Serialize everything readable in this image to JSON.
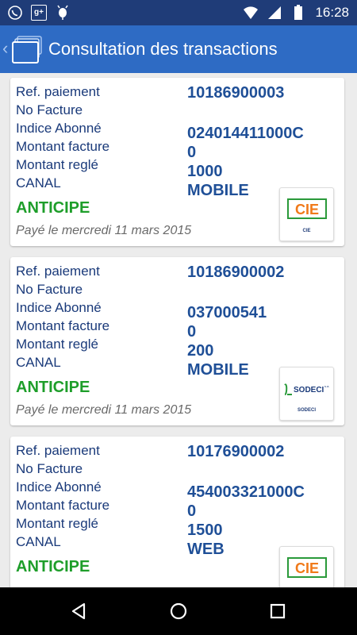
{
  "status_bar": {
    "time": "16:28",
    "left_icons": [
      "whatsapp-icon",
      "google-plus-icon",
      "android-debug-icon"
    ],
    "google_plus_label": "g+",
    "right_icons": [
      "wifi-icon",
      "cellular-signal-icon",
      "battery-icon"
    ]
  },
  "action_bar": {
    "title": "Consultation des transactions",
    "back_glyph": "‹"
  },
  "labels": {
    "ref": "Ref. paiement",
    "facture": "No Facture",
    "indice": "Indice Abonné",
    "montant_facture": "Montant facture",
    "montant_regle": "Montant reglé",
    "canal": "CANAL"
  },
  "transactions": [
    {
      "ref_paiement": "10186900003",
      "no_facture": "",
      "indice_abonne": "024014411000C",
      "montant_facture": "0",
      "montant_regle": "1000",
      "canal": "MOBILE",
      "status": "ANTICIPE",
      "pay_date": "Payé le mercredi 11 mars 2015",
      "provider": "CIE",
      "provider_logo_text": "CIE",
      "provider_caption": "CIE"
    },
    {
      "ref_paiement": "10186900002",
      "no_facture": "",
      "indice_abonne": "037000541",
      "montant_facture": "0",
      "montant_regle": "200",
      "canal": "MOBILE",
      "status": "ANTICIPE",
      "pay_date": "Payé le mercredi 11 mars 2015",
      "provider": "SODECI",
      "provider_logo_text": "SODECI",
      "provider_logo_suffix": "s.a.",
      "provider_caption": "SODECI"
    },
    {
      "ref_paiement": "10176900002",
      "no_facture": "",
      "indice_abonne": "454003321000C",
      "montant_facture": "0",
      "montant_regle": "1500",
      "canal": "WEB",
      "status": "ANTICIPE",
      "pay_date": "",
      "provider": "CIE",
      "provider_logo_text": "CIE",
      "provider_caption": ""
    }
  ],
  "colors": {
    "status_bar": "#1f3c78",
    "action_bar": "#2e6bc4",
    "label_text": "#1a3a7a",
    "value_text": "#1f4f97",
    "status_green": "#1e9e2a",
    "cie_orange": "#f07a1a",
    "cie_green": "#2a9a3a"
  },
  "nav_bar": {
    "buttons": [
      "back-nav-icon",
      "home-nav-icon",
      "recents-nav-icon"
    ]
  }
}
